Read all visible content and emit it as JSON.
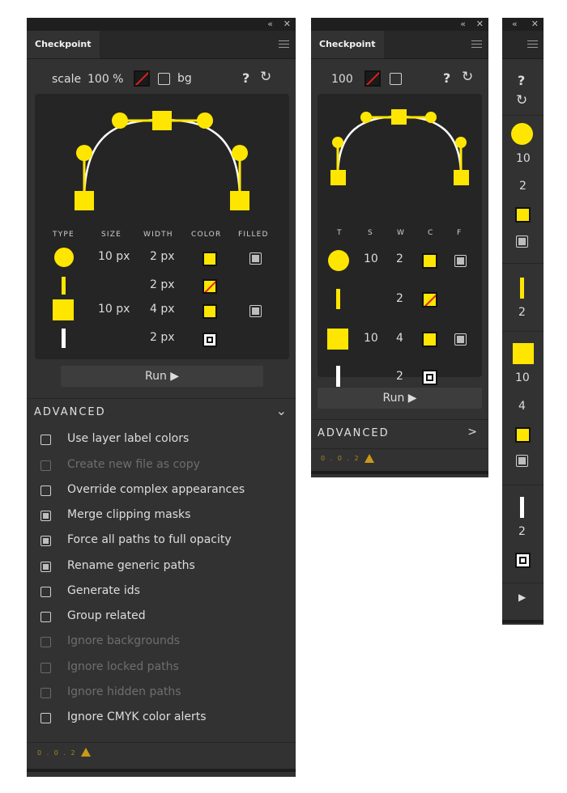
{
  "panels": {
    "large": {
      "tab": "Checkpoint",
      "scale_label": "scale",
      "scale_value": "100 %",
      "bg_label": "bg",
      "help": "?",
      "refresh": "C",
      "headers": [
        "TYPE",
        "SIZE",
        "WIDTH",
        "COLOR",
        "FILLED"
      ],
      "rows": [
        {
          "type": "circle-icon",
          "size": "10 px",
          "width": "2 px",
          "color": "yellow",
          "filled": true
        },
        {
          "type": "yellow-bar-icon",
          "size": "",
          "width": "2 px",
          "color": "yellow-none",
          "filled": false
        },
        {
          "type": "square-icon",
          "size": "10 px",
          "width": "4 px",
          "color": "yellow",
          "filled": true
        },
        {
          "type": "white-bar-icon",
          "size": "",
          "width": "2 px",
          "color": "white",
          "filled": false
        }
      ],
      "run_label": "Run ▶",
      "advanced_label": "ADVANCED",
      "advanced_chevron": "⌄",
      "options": [
        {
          "label": "Use layer label colors",
          "checked": false,
          "enabled": true
        },
        {
          "label": "Create new file as copy",
          "checked": false,
          "enabled": false
        },
        {
          "label": "Override complex appearances",
          "checked": false,
          "enabled": true
        },
        {
          "label": "Merge clipping masks",
          "checked": true,
          "enabled": true
        },
        {
          "label": "Force all paths to full opacity",
          "checked": true,
          "enabled": true
        },
        {
          "label": "Rename generic paths",
          "checked": true,
          "enabled": true
        },
        {
          "label": "Generate ids",
          "checked": false,
          "enabled": true
        },
        {
          "label": "Group related",
          "checked": false,
          "enabled": true
        },
        {
          "label": "Ignore backgrounds",
          "checked": false,
          "enabled": false
        },
        {
          "label": "Ignore locked paths",
          "checked": false,
          "enabled": false
        },
        {
          "label": "Ignore hidden paths",
          "checked": false,
          "enabled": false
        },
        {
          "label": "Ignore CMYK color alerts",
          "checked": false,
          "enabled": true
        }
      ],
      "version": "0 . 0 . 2"
    },
    "medium": {
      "tab": "Checkpoint",
      "scale_value": "100",
      "help": "?",
      "refresh": "C",
      "headers": [
        "T",
        "S",
        "W",
        "C",
        "F"
      ],
      "rows": [
        {
          "size": "10",
          "width": "2"
        },
        {
          "size": "",
          "width": "2"
        },
        {
          "size": "10",
          "width": "4"
        },
        {
          "size": "",
          "width": "2"
        }
      ],
      "run_label": "Run ▶",
      "advanced_label": "ADVANCED",
      "advanced_chevron": ">",
      "version": "0 . 0 . 2"
    },
    "narrow": {
      "help": "?",
      "refresh": "C",
      "values": [
        "10",
        "2",
        "2",
        "10",
        "4",
        "2"
      ],
      "run_icon": "▶"
    }
  },
  "window_controls": {
    "collapse": "«",
    "close": "✕"
  },
  "colors": {
    "accent": "#ffe600",
    "panel": "#323232",
    "inner": "#252525",
    "warn": "#c99a16"
  }
}
